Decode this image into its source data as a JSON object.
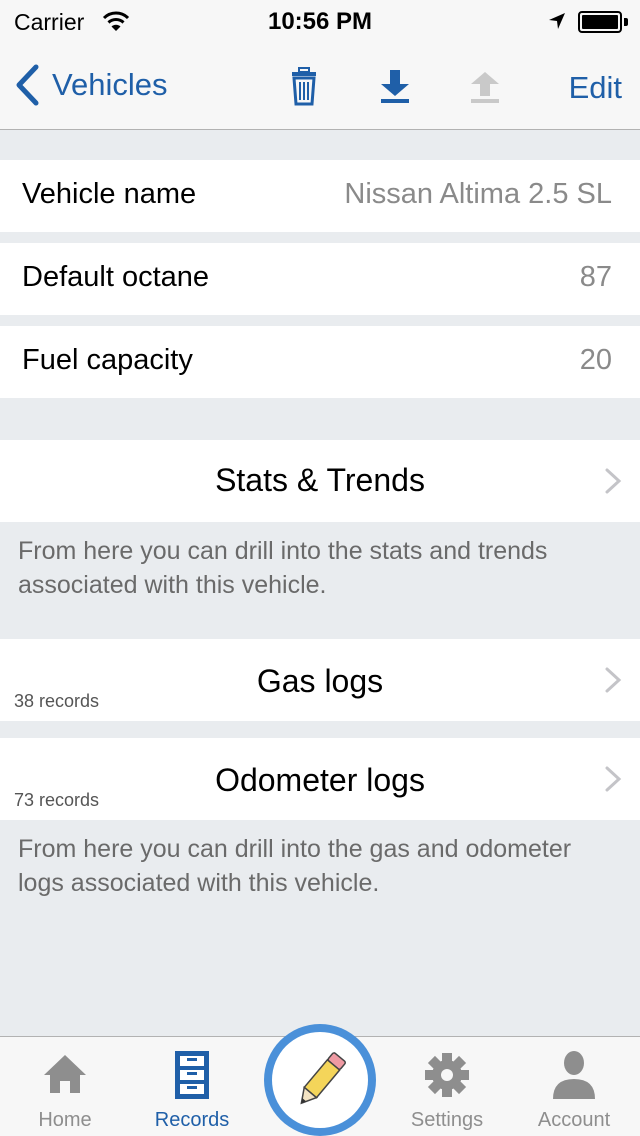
{
  "status": {
    "carrier": "Carrier",
    "time": "10:56 PM"
  },
  "nav": {
    "back_label": "Vehicles",
    "edit_label": "Edit",
    "icons": [
      "trash-icon",
      "download-icon",
      "upload-icon"
    ]
  },
  "fields": [
    {
      "label": "Vehicle name",
      "value": "Nissan Altima 2.5 SL"
    },
    {
      "label": "Default octane",
      "value": "87"
    },
    {
      "label": "Fuel capacity",
      "value": "20"
    }
  ],
  "stats": {
    "title": "Stats & Trends",
    "footer": "From here you can drill into the stats and trends associated with this vehicle."
  },
  "logs": {
    "gas": {
      "title": "Gas logs",
      "count": "38 records"
    },
    "odometer": {
      "title": "Odometer logs",
      "count": "73 records"
    },
    "footer": "From here you can drill into the gas and odometer logs associated with this vehicle."
  },
  "tabs": [
    {
      "label": "Home",
      "icon": "home-icon",
      "active": false
    },
    {
      "label": "Records",
      "icon": "records-icon",
      "active": true
    },
    {
      "label": "Settings",
      "icon": "gear-icon",
      "active": false
    },
    {
      "label": "Account",
      "icon": "person-icon",
      "active": false
    }
  ],
  "colors": {
    "accent": "#1f5fa8",
    "background": "#e9ecef",
    "compose_ring": "#4a90d9",
    "pencil": "#f4d55a"
  }
}
